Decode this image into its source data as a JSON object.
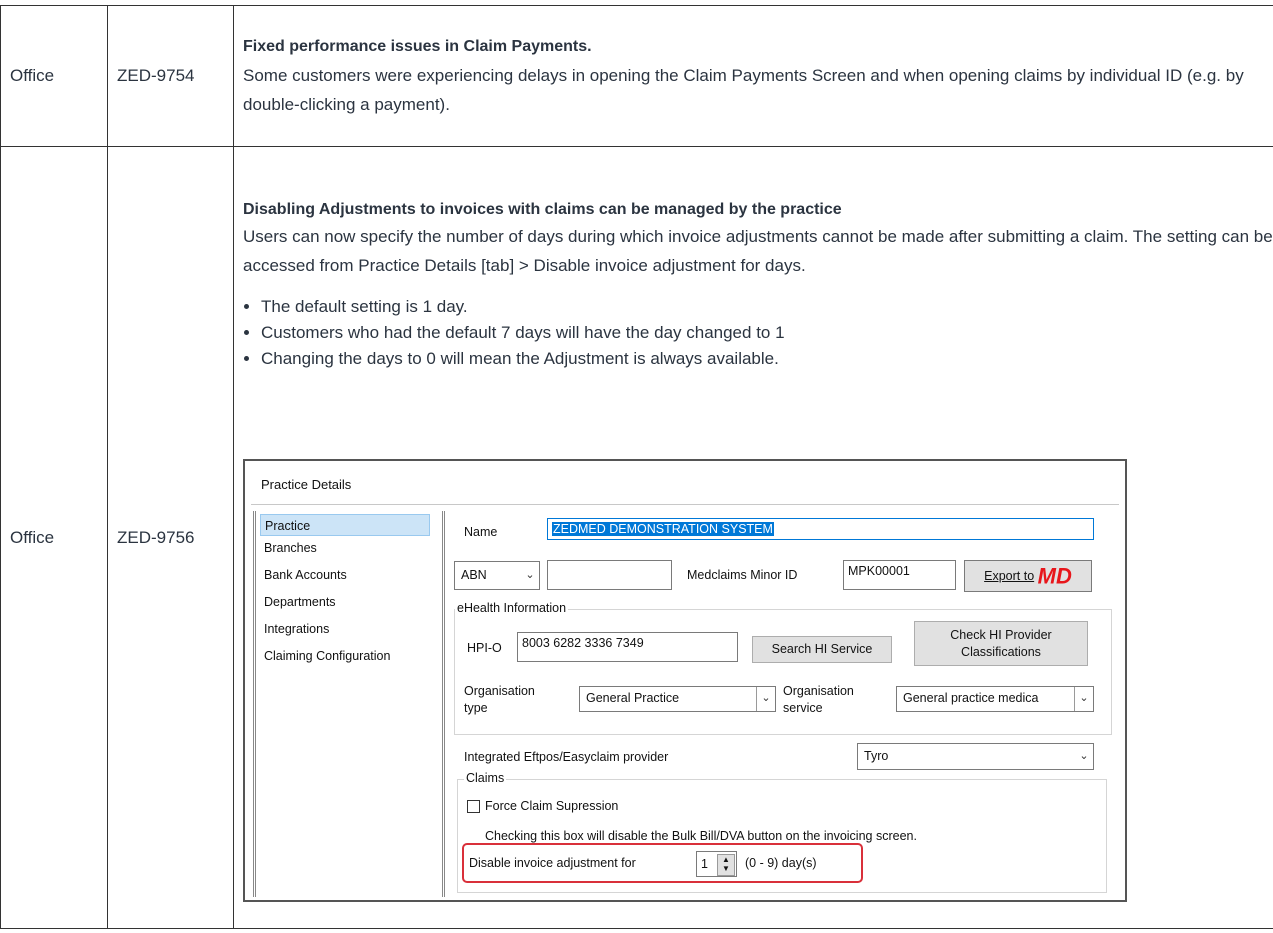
{
  "rows": [
    {
      "area": "Office",
      "id": "ZED-9754",
      "title": "Fixed performance issues in Claim Payments.",
      "description": "Some customers were experiencing delays in opening the Claim Payments Screen and when opening claims by individual ID (e.g. by double-clicking a payment)."
    },
    {
      "area": "Office",
      "id": "ZED-9756",
      "title": "Disabling Adjustments to invoices with claims can be managed by the practice",
      "description": "Users can now specify the number of days during which invoice adjustments cannot be made after submitting a claim. The setting can be accessed from Practice Details [tab] > Disable invoice adjustment for days.",
      "bullets": [
        "The default setting is 1 day.",
        "Customers who had the default 7 days will have the day changed to 1",
        "Changing the days to 0 will mean the Adjustment is always available."
      ]
    }
  ],
  "dialog": {
    "title": "Practice Details",
    "nav": [
      "Practice",
      "Branches",
      "Bank Accounts",
      "Departments",
      "Integrations",
      "Claiming Configuration"
    ],
    "name_label": "Name",
    "name_value": "ZEDMED DEMONSTRATION SYSTEM",
    "abn_select": "ABN",
    "abn_value": "",
    "medclaims_label": "Medclaims Minor ID",
    "medclaims_value": "MPK00001",
    "export_label": "Export to",
    "export_logo": "MD",
    "ehealth_legend": "eHealth Information",
    "hpio_label": "HPI-O",
    "hpio_value": "8003 6282 3336 7349",
    "search_hi": "Search HI Service",
    "check_hi": "Check HI Provider Classifications",
    "org_type_label": "Organisation type",
    "org_type_value": "General Practice",
    "org_service_label": "Organisation service",
    "org_service_value": "General practice medica",
    "eftpos_label": "Integrated Eftpos/Easyclaim provider",
    "eftpos_value": "Tyro",
    "claims_legend": "Claims",
    "force_claim_label": "Force Claim Supression",
    "force_claim_checked": false,
    "force_claim_note": "Checking this box will disable the Bulk Bill/DVA button on the invoicing screen.",
    "disable_label": "Disable invoice adjustment for",
    "disable_value": "1",
    "disable_range": "(0 - 9) day(s)",
    "highlight_color": "#d9303a",
    "selection_color": "#0078d7"
  }
}
